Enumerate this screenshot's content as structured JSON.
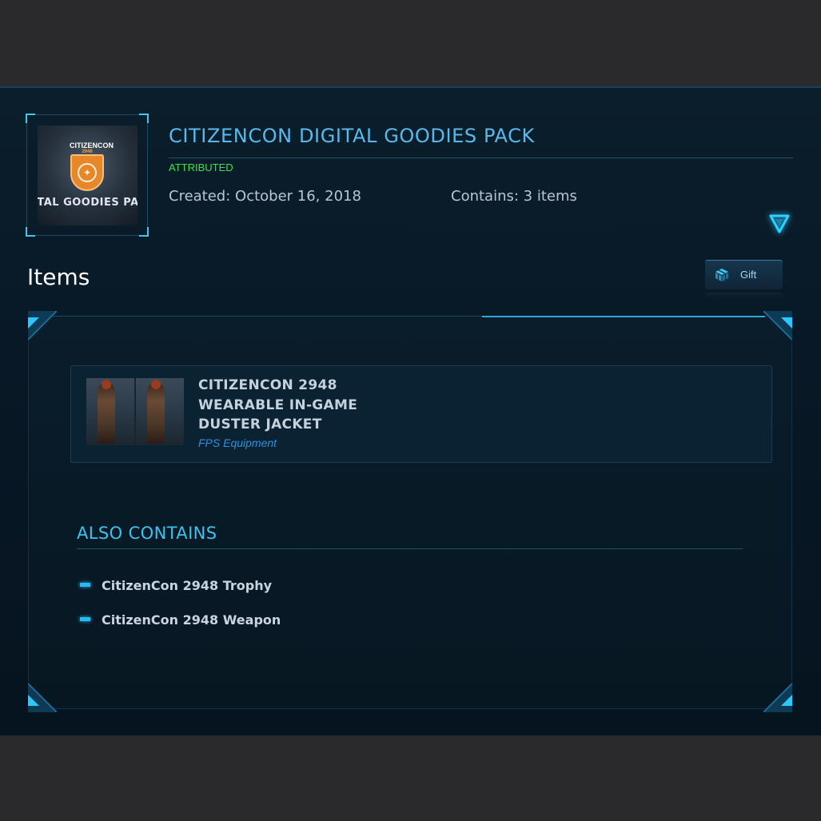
{
  "pack": {
    "thumb_logo_text": "CITIZENCON",
    "thumb_logo_year": "2948",
    "thumb_caption": "ITAL GOODIES PA",
    "title": "CITIZENCON DIGITAL GOODIES PACK",
    "status": "ATTRIBUTED",
    "created": "Created: October 16, 2018",
    "contains": "Contains: 3 items"
  },
  "items_section": {
    "heading": "Items",
    "gift_label": "Gift",
    "item": {
      "name_lines": [
        "CITIZENCON 2948",
        "WEARABLE IN-GAME",
        "DUSTER JACKET"
      ],
      "type": "FPS Equipment"
    },
    "also_contains": {
      "heading": "ALSO CONTAINS",
      "entries": [
        "CitizenCon 2948 Trophy",
        "CitizenCon 2948 Weapon"
      ]
    }
  },
  "colors": {
    "accent": "#3cc2ee",
    "title": "#59b9ec",
    "status": "#3fe04a",
    "link": "#2f8fe0"
  },
  "icons": [
    "chevron-down-icon",
    "gift-cube-icon",
    "shield-logo-icon"
  ]
}
